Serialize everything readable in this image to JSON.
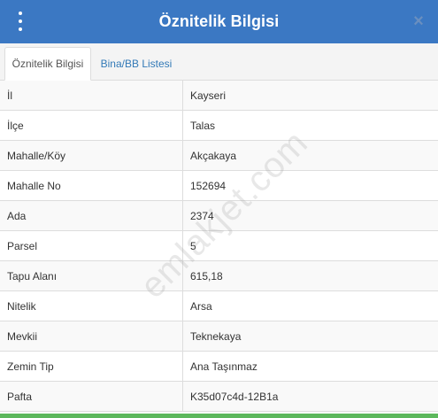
{
  "header": {
    "title": "Öznitelik Bilgisi",
    "close_glyph": "×"
  },
  "tabs": [
    {
      "label": "Öznitelik Bilgisi",
      "active": true
    },
    {
      "label": "Bina/BB Listesi",
      "active": false
    }
  ],
  "rows": [
    {
      "key": "İl",
      "value": "Kayseri"
    },
    {
      "key": "İlçe",
      "value": "Talas"
    },
    {
      "key": "Mahalle/Köy",
      "value": "Akçakaya"
    },
    {
      "key": "Mahalle No",
      "value": "152694"
    },
    {
      "key": "Ada",
      "value": "2374"
    },
    {
      "key": "Parsel",
      "value": "5"
    },
    {
      "key": "Tapu Alanı",
      "value": "615,18"
    },
    {
      "key": "Nitelik",
      "value": "Arsa"
    },
    {
      "key": "Mevkii",
      "value": "Teknekaya"
    },
    {
      "key": "Zemin Tip",
      "value": "Ana Taşınmaz"
    },
    {
      "key": "Pafta",
      "value": "K35d07c4d-12B1a"
    }
  ],
  "watermark": "emlakjet.com",
  "colors": {
    "header": "#3b78c3",
    "tab_link": "#337ab7",
    "bottom_bar": "#5cb85c"
  }
}
